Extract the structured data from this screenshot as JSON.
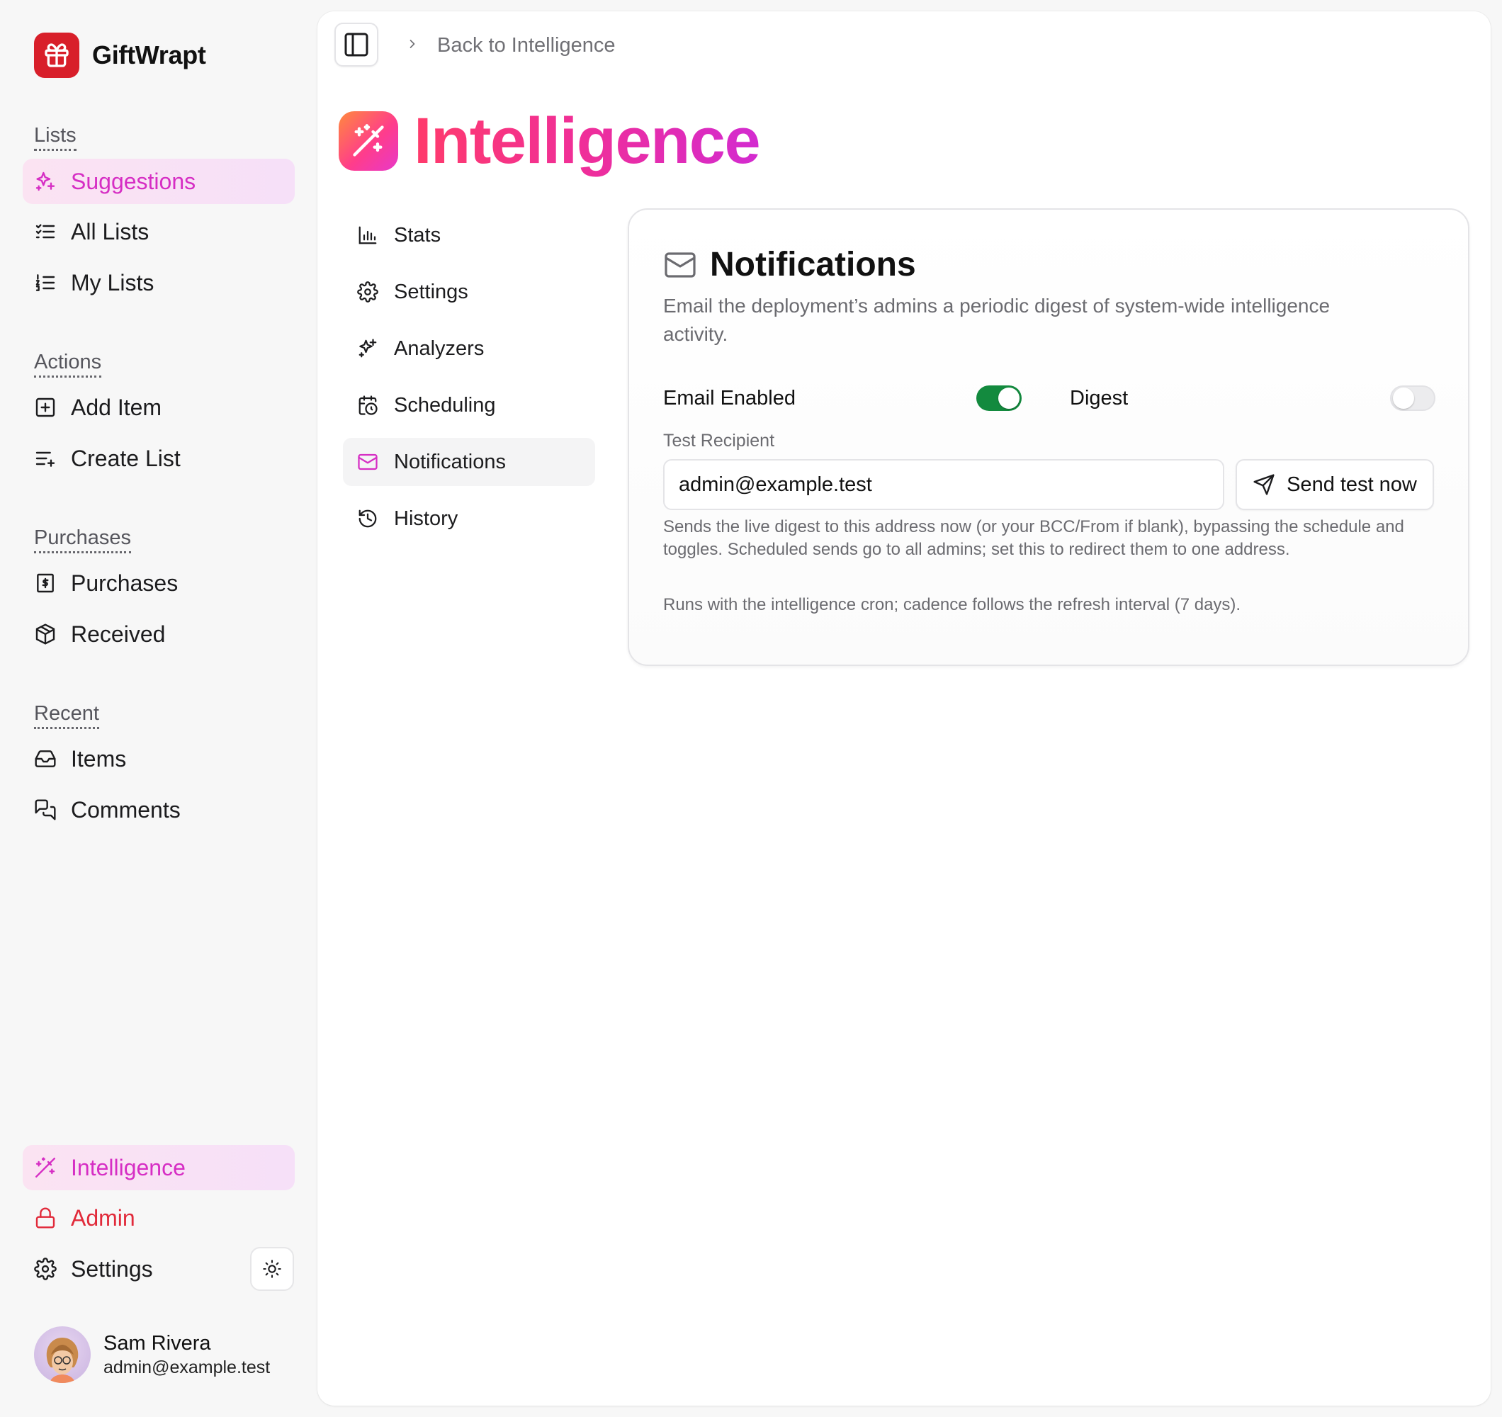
{
  "brand": {
    "name": "GiftWrapt"
  },
  "sidebar": {
    "sections": [
      {
        "title": "Lists"
      },
      {
        "title": "Actions"
      },
      {
        "title": "Purchases"
      },
      {
        "title": "Recent"
      }
    ],
    "lists": [
      {
        "label": "Suggestions",
        "icon": "sparkles-icon",
        "active": true
      },
      {
        "label": "All Lists",
        "icon": "list-checks-icon"
      },
      {
        "label": "My Lists",
        "icon": "list-ordered-icon"
      }
    ],
    "actions": [
      {
        "label": "Add Item",
        "icon": "square-plus-icon"
      },
      {
        "label": "Create List",
        "icon": "list-plus-icon"
      }
    ],
    "purchases": [
      {
        "label": "Purchases",
        "icon": "receipt-icon"
      },
      {
        "label": "Received",
        "icon": "package-open-icon"
      }
    ],
    "recent": [
      {
        "label": "Items",
        "icon": "inbox-icon"
      },
      {
        "label": "Comments",
        "icon": "messages-icon"
      }
    ],
    "bottom": [
      {
        "label": "Intelligence",
        "icon": "wand-sparkles-icon",
        "active": true
      },
      {
        "label": "Admin",
        "icon": "lock-icon"
      },
      {
        "label": "Settings",
        "icon": "gear-icon"
      }
    ],
    "theme_toggle_icon": "sun-icon",
    "user": {
      "name": "Sam Rivera",
      "email": "admin@example.test"
    }
  },
  "header": {
    "breadcrumb": "Back to Intelligence",
    "title": "Intelligence"
  },
  "subnav": [
    {
      "label": "Stats",
      "icon": "bar-chart-icon"
    },
    {
      "label": "Settings",
      "icon": "gear-icon"
    },
    {
      "label": "Analyzers",
      "icon": "sparkles-icon"
    },
    {
      "label": "Scheduling",
      "icon": "calendar-clock-icon"
    },
    {
      "label": "Notifications",
      "icon": "mail-icon",
      "active": true
    },
    {
      "label": "History",
      "icon": "history-icon"
    }
  ],
  "card": {
    "title": "Notifications",
    "description": "Email the deployment’s admins a periodic digest of system-wide intelligence activity.",
    "email_enabled": {
      "label": "Email Enabled",
      "on": true
    },
    "digest": {
      "label": "Digest",
      "on": false
    },
    "test_recipient": {
      "label": "Test Recipient",
      "value": "admin@example.test"
    },
    "send_button": "Send test now",
    "help": "Sends the live digest to this address now (or your BCC/From if blank), bypassing the schedule and toggles. Scheduled sends go to all admins; set this to redirect them to one address.",
    "footer": "Runs with the intelligence cron; cadence follows the refresh interval (7 days)."
  },
  "colors": {
    "accent_pink": "#d62ec4",
    "danger": "#e12a3a",
    "toggle_on": "#138a3e",
    "brand_red": "#d81f2a"
  }
}
